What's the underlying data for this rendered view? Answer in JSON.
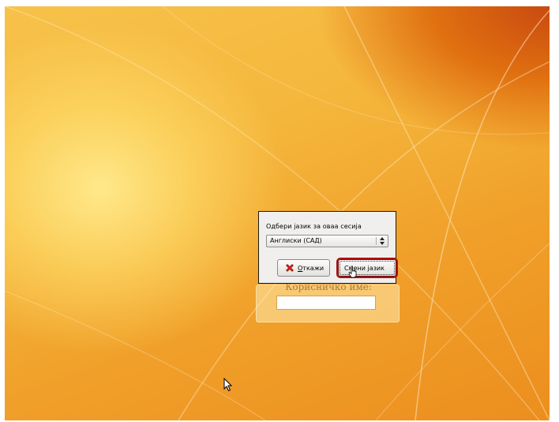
{
  "login": {
    "username_label": "Корисничко име:",
    "username_value": ""
  },
  "dialog": {
    "title": "Одбери јазик за оваа сесија",
    "language_selected": "Англиски (САД)",
    "cancel_prefix": "О",
    "cancel_rest": "ткажи",
    "change_label": "Смени јазик"
  },
  "colors": {
    "highlight": "#b01010",
    "dialog_bg": "#f0efed"
  },
  "icons": {
    "cancel": "red-x-icon",
    "combo": "up-down-arrows-icon",
    "pointer": "arrow-cursor-icon"
  }
}
